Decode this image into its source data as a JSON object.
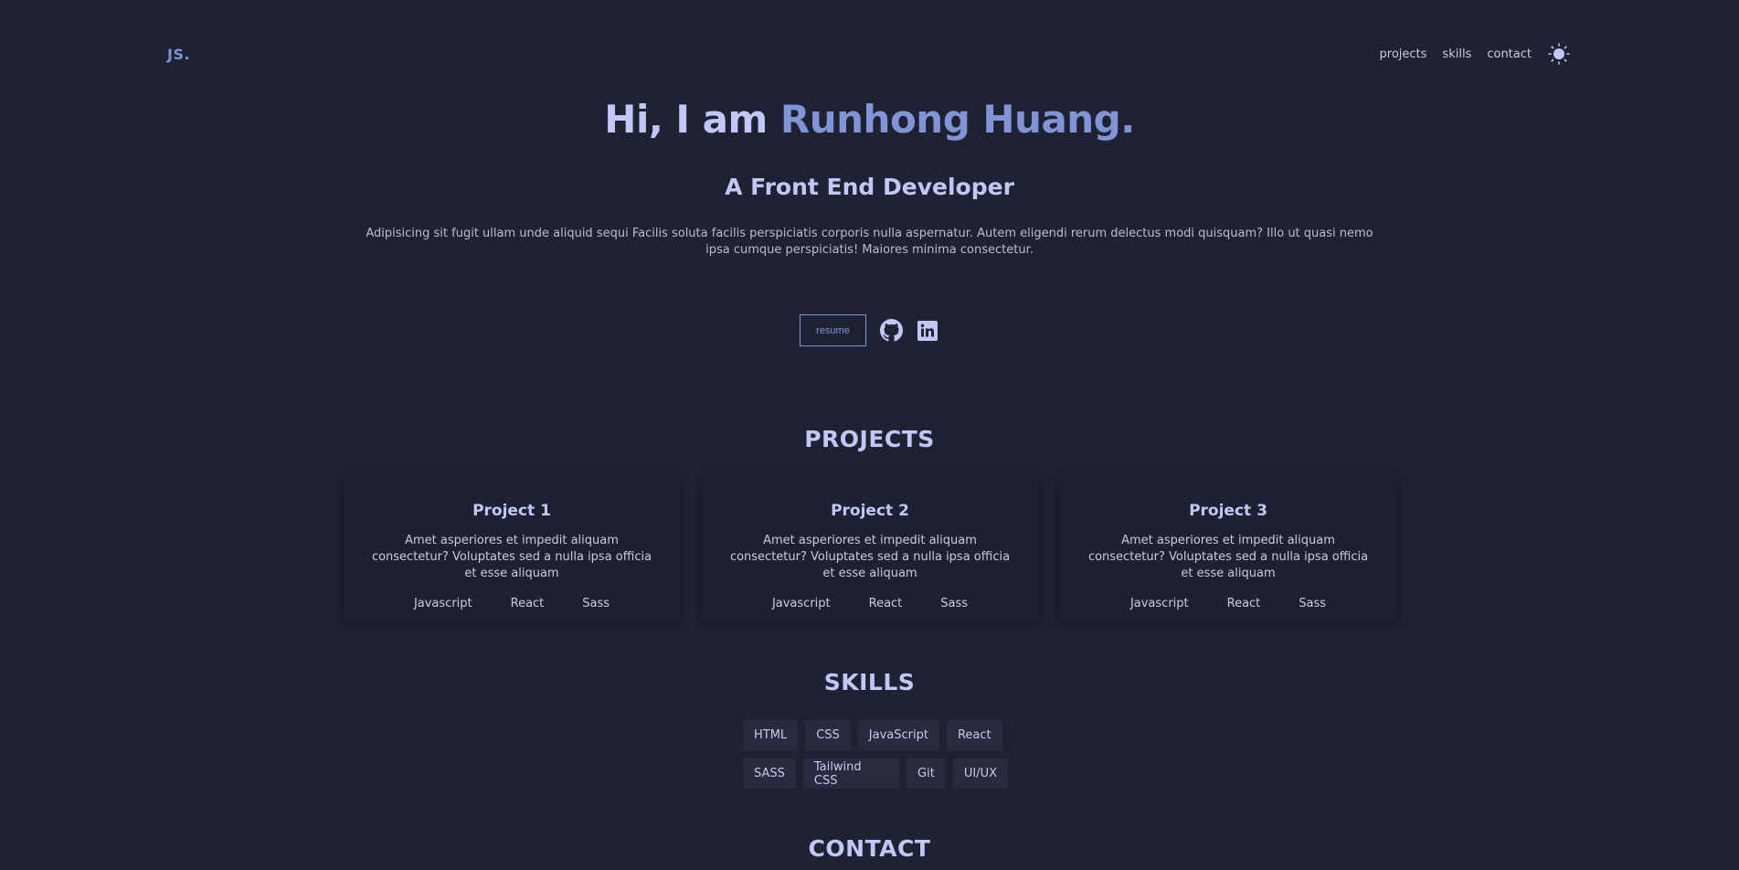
{
  "header": {
    "logo": "JS.",
    "nav": [
      "projects",
      "skills",
      "contact"
    ],
    "theme_icon": "sun-icon"
  },
  "hero": {
    "greeting": "Hi, I am ",
    "name": "Runhong Huang.",
    "subtitle": "A Front End Developer",
    "description": "Adipisicing sit fugit ullam unde aliquid sequi Facilis soluta facilis perspiciatis corporis nulla aspernatur. Autem eligendi rerum delectus modi quisquam? Illo ut quasi nemo ipsa cumque perspiciatis! Maiores minima consectetur.",
    "resume_label": "resume",
    "icons": [
      "github-icon",
      "linkedin-icon"
    ]
  },
  "projects": {
    "title": "PROJECTS",
    "items": [
      {
        "title": "Project 1",
        "description": "Amet asperiores et impedit aliquam consectetur? Voluptates sed a nulla ipsa officia et esse aliquam",
        "tags": [
          "Javascript",
          "React",
          "Sass"
        ]
      },
      {
        "title": "Project 2",
        "description": "Amet asperiores et impedit aliquam consectetur? Voluptates sed a nulla ipsa officia et esse aliquam",
        "tags": [
          "Javascript",
          "React",
          "Sass"
        ]
      },
      {
        "title": "Project 3",
        "description": "Amet asperiores et impedit aliquam consectetur? Voluptates sed a nulla ipsa officia et esse aliquam",
        "tags": [
          "Javascript",
          "React",
          "Sass"
        ]
      }
    ]
  },
  "skills": {
    "title": "SKILLS",
    "rows": [
      [
        "HTML",
        "CSS",
        "JavaScript",
        "React"
      ],
      [
        "SASS",
        "Tailwind CSS",
        "Git",
        "UI/UX"
      ]
    ]
  },
  "contact": {
    "title": "CONTACT"
  },
  "colors": {
    "background": "#1f2233",
    "accent": "#8094d6",
    "heading": "#c3c7f7",
    "text": "#c9cbe8"
  }
}
